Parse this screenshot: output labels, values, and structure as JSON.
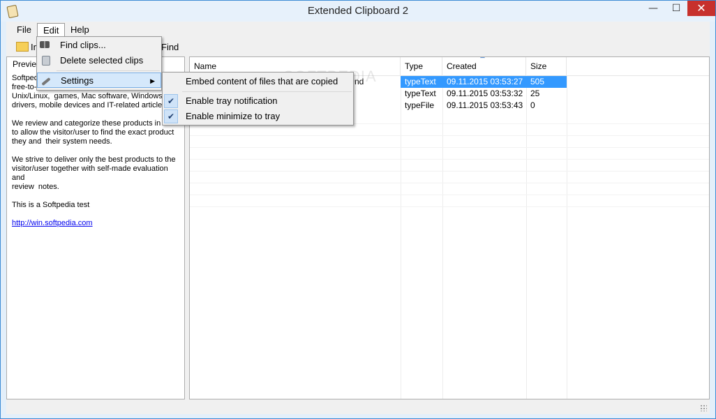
{
  "window": {
    "title": "Extended Clipboard 2",
    "min": "—",
    "max": "☐",
    "close": "✕"
  },
  "menubar": {
    "file": "File",
    "edit": "Edit",
    "help": "Help"
  },
  "toolbar": {
    "import": "Im",
    "find": "Find"
  },
  "preview": {
    "label": "Preview",
    "lines": [
      "Softped",
      "free-to-t",
      "Unix/Linux,  games, Mac software, Windows",
      "drivers, mobile devices and IT-related articles."
    ],
    "p2": "We review and categorize these products in order\nto allow the visitor/user to find the exact product\nthey and  their system needs.",
    "p3": "We strive to deliver only the best products to the\nvisitor/user together with self-made evaluation and\nreview  notes.",
    "p4": "This is a Softpedia test",
    "link": "http://win.softpedia.com"
  },
  "list": {
    "columns": {
      "name": "Name",
      "type": "Type",
      "created": "Created",
      "size": "Size"
    },
    "rows": [
      {
        "name": "nd",
        "type": "typeText",
        "created": "09.11.2015 03:53:27",
        "size": "505"
      },
      {
        "name": "",
        "type": "typeText",
        "created": "09.11.2015 03:53:32",
        "size": "25"
      },
      {
        "name": "",
        "type": "typeFile",
        "created": "09.11.2015 03:53:43",
        "size": "0"
      }
    ]
  },
  "edit_menu": {
    "find": "Find clips...",
    "delete": "Delete selected clips",
    "settings": "Settings",
    "arrow": "▶"
  },
  "settings_menu": {
    "embed": "Embed content of files that are copied",
    "tray_notify": "Enable tray notification",
    "minimize": "Enable minimize to tray",
    "check": "✔"
  },
  "watermark": "SOFTPEDIA"
}
